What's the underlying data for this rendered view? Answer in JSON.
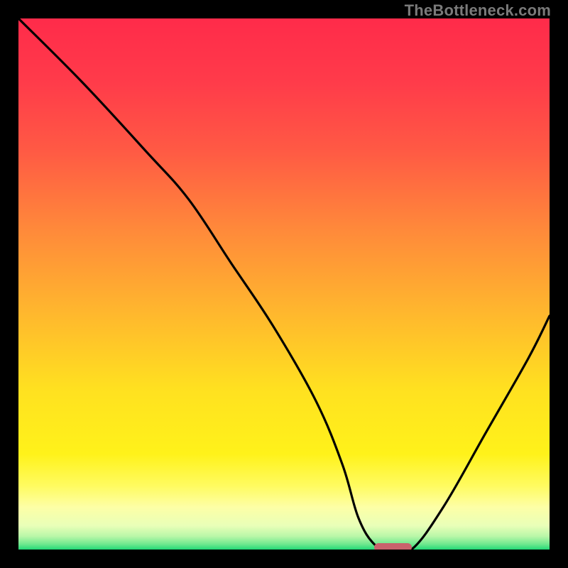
{
  "watermark": "TheBottleneck.com",
  "chart_data": {
    "type": "line",
    "title": "",
    "xlabel": "",
    "ylabel": "",
    "xlim": [
      0,
      100
    ],
    "ylim": [
      0,
      100
    ],
    "grid": false,
    "legend": false,
    "series": [
      {
        "name": "bottleneck-curve",
        "x": [
          0,
          12,
          24,
          32,
          40,
          48,
          56,
          61,
          64,
          67,
          70,
          74,
          80,
          88,
          96,
          100
        ],
        "values": [
          100,
          88,
          75,
          66,
          54,
          42,
          28,
          16,
          6,
          1,
          0,
          0,
          8,
          22,
          36,
          44
        ]
      }
    ],
    "marker": {
      "x_start": 67,
      "x_end": 74,
      "y": 0,
      "color": "#c9626c"
    },
    "gradient_stops": [
      {
        "offset": 0.0,
        "color": "#ff2b4a"
      },
      {
        "offset": 0.12,
        "color": "#ff3b4a"
      },
      {
        "offset": 0.25,
        "color": "#ff5a44"
      },
      {
        "offset": 0.4,
        "color": "#ff8a3a"
      },
      {
        "offset": 0.55,
        "color": "#ffb62e"
      },
      {
        "offset": 0.7,
        "color": "#ffe120"
      },
      {
        "offset": 0.82,
        "color": "#fff21a"
      },
      {
        "offset": 0.88,
        "color": "#fffb60"
      },
      {
        "offset": 0.92,
        "color": "#fdffa6"
      },
      {
        "offset": 0.955,
        "color": "#e9ffb8"
      },
      {
        "offset": 0.975,
        "color": "#b9f7a8"
      },
      {
        "offset": 0.99,
        "color": "#6ee88e"
      },
      {
        "offset": 1.0,
        "color": "#22d876"
      }
    ]
  }
}
